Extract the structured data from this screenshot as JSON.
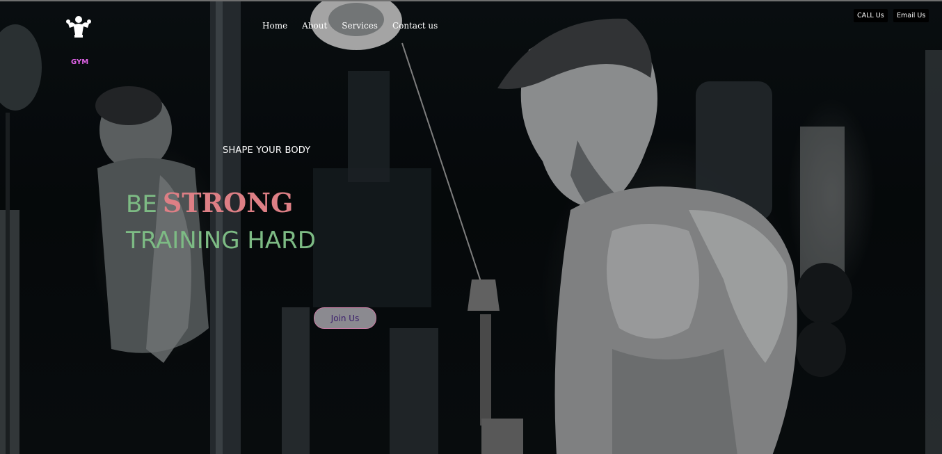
{
  "brand": {
    "logo_icon": "bodybuilder-logo-icon",
    "name": "GYM",
    "name_color": "#e063e8"
  },
  "nav": {
    "items": [
      {
        "label": "Home"
      },
      {
        "label": "About"
      },
      {
        "label": "Services"
      },
      {
        "label": "Contact us"
      }
    ]
  },
  "contact_buttons": {
    "call_label": "CALL Us",
    "email_label": "Email Us"
  },
  "hero": {
    "tagline": "SHAPE YOUR BODY",
    "headline_prefix": "BE",
    "headline_emphasis": "STRONG",
    "headline_line2": "TRAINING HARD",
    "cta_label": "Join Us",
    "background_image": "gym-athlete-cable-machine-photo",
    "colors": {
      "green": "#7dbb84",
      "pink": "#dd7f85",
      "cta_text": "#3a1d6b"
    }
  }
}
